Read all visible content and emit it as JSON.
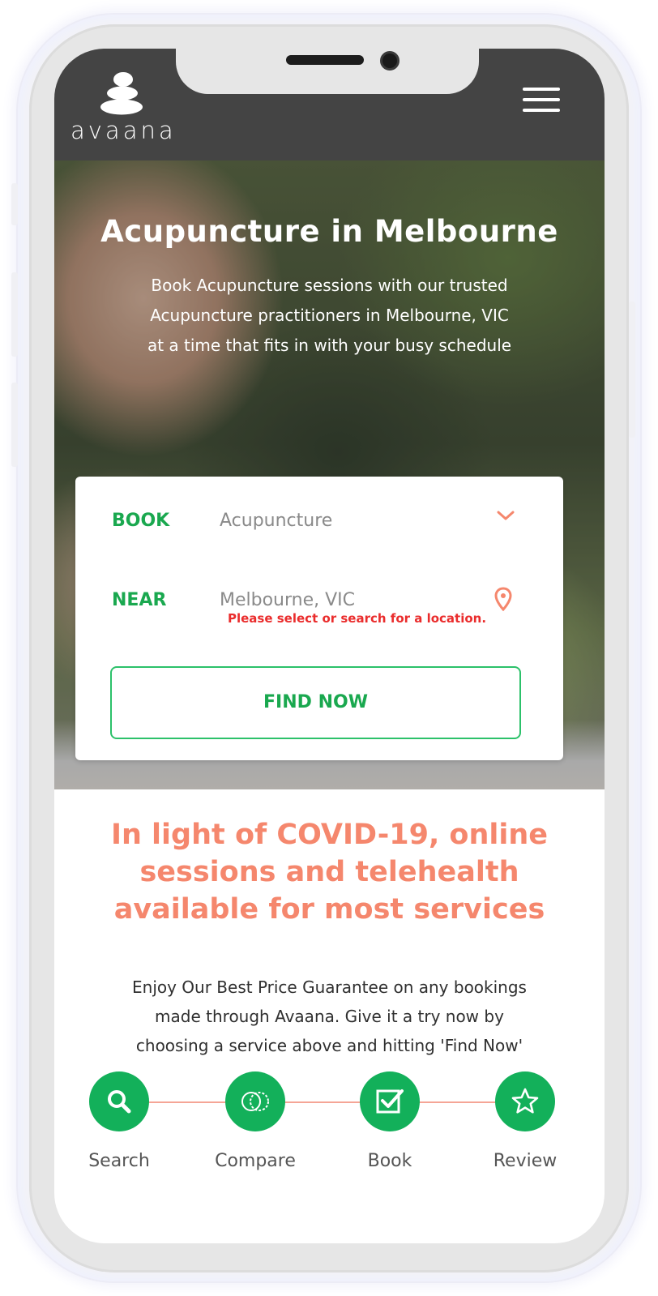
{
  "header": {
    "logo_text": "avaana",
    "background_color": "#444444"
  },
  "hero": {
    "title": "Acupuncture in Melbourne",
    "subtitle_lines": [
      "Book Acupuncture sessions with our trusted",
      "Acupuncture practitioners in Melbourne, VIC",
      "at a time that fits in with your busy schedule"
    ]
  },
  "search": {
    "book_label": "BOOK",
    "book_value": "Acupuncture",
    "near_label": "NEAR",
    "near_value": "Melbourne, VIC",
    "location_error": "Please select or search for a location.",
    "find_button": "FIND NOW",
    "accent_color": "#1aa84f",
    "error_color": "#ea2c2c"
  },
  "covid_notice": {
    "lines": [
      "In light of COVID-19, online",
      "sessions and telehealth",
      "available for most services"
    ],
    "color": "#f5876d"
  },
  "promo": {
    "lines": [
      "Enjoy Our Best Price Guarantee on any bookings",
      "made through Avaana. Give it a try now by",
      "choosing a service above and hitting 'Find Now'"
    ]
  },
  "steps": [
    {
      "label": "Search",
      "icon": "search-icon"
    },
    {
      "label": "Compare",
      "icon": "compare-icon"
    },
    {
      "label": "Book",
      "icon": "checkbox-icon"
    },
    {
      "label": "Review",
      "icon": "star-icon"
    }
  ],
  "colors": {
    "step_green": "#13b05a",
    "step_line": "#f5a596"
  }
}
